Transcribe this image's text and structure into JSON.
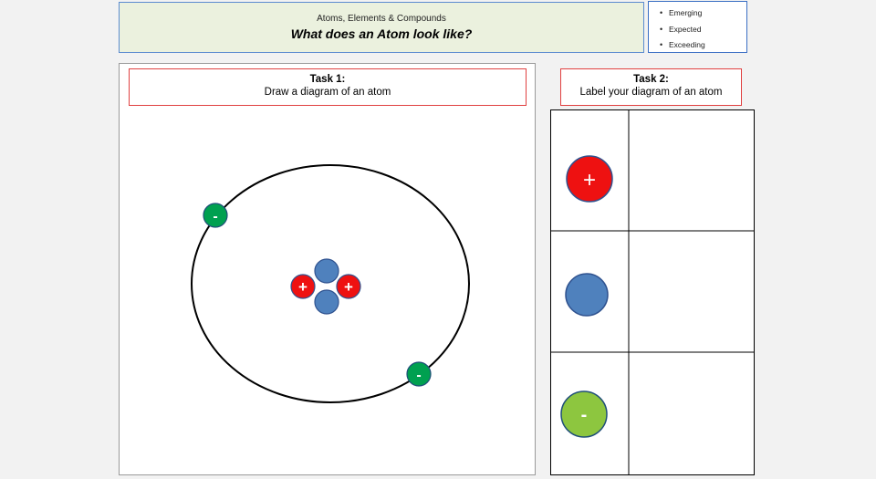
{
  "header": {
    "subtitle": "Atoms, Elements & Compounds",
    "title": "What does an Atom look like?"
  },
  "levels": {
    "bullet": "•",
    "items": [
      "Emerging",
      "Expected",
      "Exceeding"
    ]
  },
  "task1": {
    "title": "Task 1:",
    "instruction": "Draw a diagram of an atom"
  },
  "task2": {
    "title": "Task 2:",
    "instruction": "Label your diagram of an atom"
  },
  "symbols": {
    "plus": "+",
    "minus": "-"
  },
  "colors": {
    "proton": "#ee1111",
    "neutron": "#4f81bd",
    "electron_diagram": "#00a050",
    "electron_table": "#8dc63f",
    "task_border": "#e04040",
    "header_bg": "#ebf1de"
  }
}
